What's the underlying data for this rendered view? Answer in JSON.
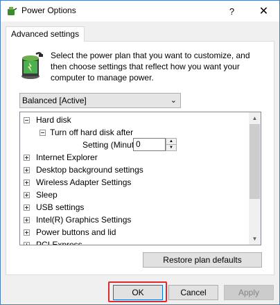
{
  "window": {
    "title": "Power Options",
    "help_glyph": "?",
    "close_glyph": "✕"
  },
  "tabs": [
    {
      "label": "Advanced settings"
    }
  ],
  "description": "Select the power plan that you want to customize, and then choose settings that reflect how you want your computer to manage power.",
  "plan_select": {
    "value": "Balanced [Active]",
    "arrow": "⌄"
  },
  "tree": {
    "items": [
      {
        "label": "Hard disk",
        "expanded": true
      },
      {
        "label": "Turn off hard disk after",
        "expanded": true
      },
      {
        "label": "Setting (Minutes):",
        "value": "0"
      },
      {
        "label": "Internet Explorer"
      },
      {
        "label": "Desktop background settings"
      },
      {
        "label": "Wireless Adapter Settings"
      },
      {
        "label": "Sleep"
      },
      {
        "label": "USB settings"
      },
      {
        "label": "Intel(R) Graphics Settings"
      },
      {
        "label": "Power buttons and lid"
      },
      {
        "label": "PCI Express"
      }
    ]
  },
  "buttons": {
    "restore": "Restore plan defaults",
    "ok": "OK",
    "cancel": "Cancel",
    "apply": "Apply"
  },
  "colors": {
    "accent": "#0078d7",
    "highlight": "#e0282e"
  }
}
